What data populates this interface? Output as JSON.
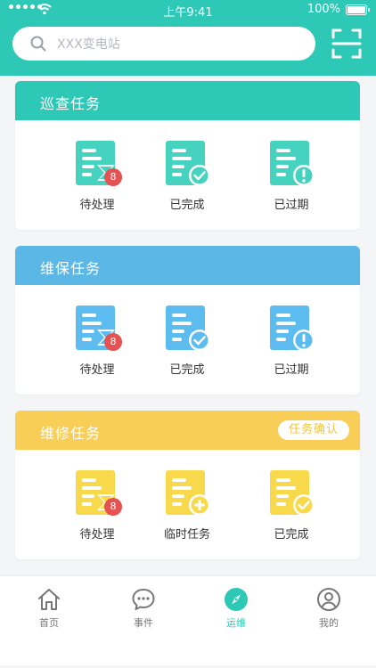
{
  "status_bar": {
    "time": "上午9:41",
    "battery": "100%"
  },
  "search": {
    "placeholder": "XXX变电站"
  },
  "inspection": {
    "title": "巡查任务",
    "color": "#2ec8b6",
    "items": [
      {
        "label": "待处理",
        "badge": "8",
        "icon": "document-hourglass-icon"
      },
      {
        "label": "已完成",
        "icon": "document-check-icon"
      },
      {
        "label": "已过期",
        "icon": "document-alert-icon"
      }
    ]
  },
  "maintenance": {
    "title": "维保任务",
    "color": "#5bb8e6",
    "items": [
      {
        "label": "待处理",
        "badge": "8",
        "icon": "document-hourglass-icon"
      },
      {
        "label": "已完成",
        "icon": "document-check-icon"
      },
      {
        "label": "已过期",
        "icon": "document-alert-icon"
      }
    ]
  },
  "repair": {
    "title": "维修任务",
    "action": "任务确认",
    "color": "#f8ce56",
    "items": [
      {
        "label": "待处理",
        "badge": "8",
        "icon": "document-hourglass-icon"
      },
      {
        "label": "临时任务",
        "icon": "document-add-icon"
      },
      {
        "label": "已完成",
        "icon": "document-check-icon"
      }
    ]
  },
  "tabbar": {
    "active_color": "#2ec8b6",
    "items": [
      {
        "label": "首页",
        "icon": "home-icon"
      },
      {
        "label": "事件",
        "icon": "chat-bubble-icon"
      },
      {
        "label": "运维",
        "icon": "compass-icon",
        "active": true
      },
      {
        "label": "我的",
        "icon": "user-icon"
      }
    ]
  }
}
